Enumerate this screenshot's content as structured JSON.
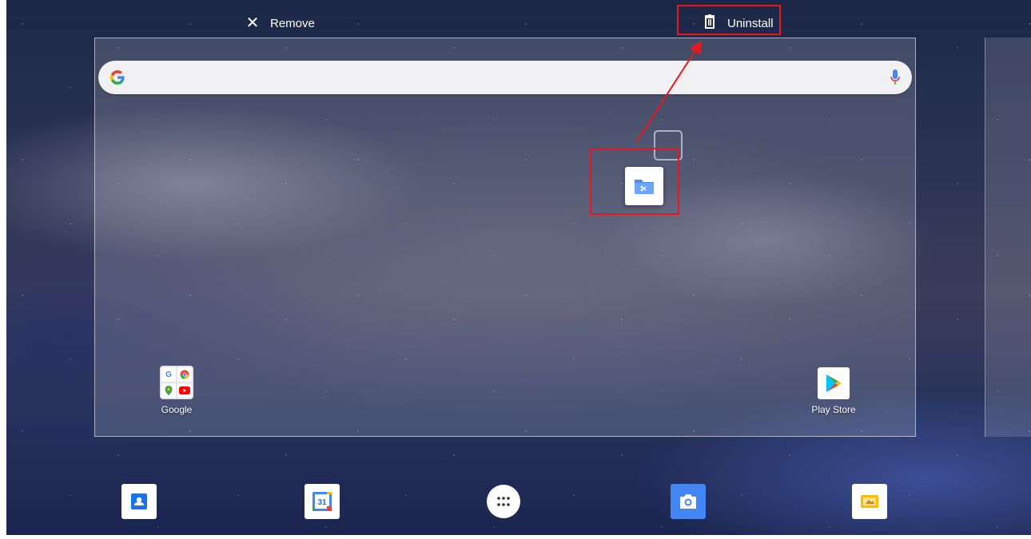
{
  "drop_bar": {
    "remove_label": "Remove",
    "uninstall_label": "Uninstall"
  },
  "home": {
    "google_folder_label": "Google",
    "play_store_label": "Play Store"
  },
  "dock": {
    "calendar_day": "31"
  },
  "colors": {
    "highlight": "#e8171e",
    "files_blue": "#4b8df8",
    "camera_blue": "#4285f4",
    "slides_yellow": "#fbbc04"
  },
  "icons": [
    "close-icon",
    "trash-icon",
    "google-g-icon",
    "mic-icon",
    "files-icon",
    "contacts-icon",
    "calendar-icon",
    "all-apps-icon",
    "camera-icon",
    "slides-icon",
    "play-store-icon"
  ]
}
